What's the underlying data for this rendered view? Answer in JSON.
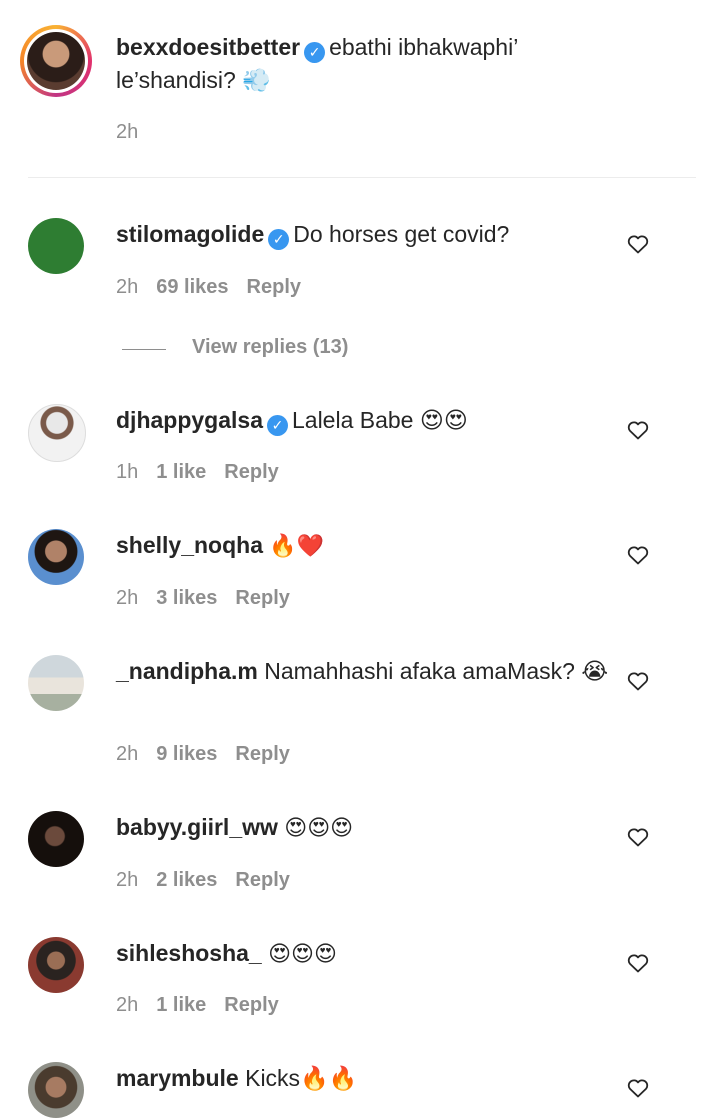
{
  "caption": {
    "username": "bexxdoesitbetter",
    "text": "ebathi ibhakwaphi’ le’shandisi? 💨",
    "time": "2h"
  },
  "comments": [
    {
      "username": "stilomagolide",
      "verified": true,
      "text": "Do horses get covid?",
      "time": "2h",
      "likes": "69 likes",
      "reply": "Reply",
      "avatar_color": "#2e7d32"
    },
    {
      "username": "djhappygalsa",
      "verified": true,
      "text": "Lalela Babe 😍😍",
      "time": "1h",
      "likes": "1 like",
      "reply": "Reply"
    },
    {
      "username": "shelly_noqha",
      "verified": false,
      "text": "🔥❤️",
      "time": "2h",
      "likes": "3 likes",
      "reply": "Reply"
    },
    {
      "username": "_nandipha.m",
      "verified": false,
      "text": "Namahhashi afaka amaMask? 😭",
      "time": "2h",
      "likes": "9 likes",
      "reply": "Reply"
    },
    {
      "username": "babyy.giirl_ww",
      "verified": false,
      "text": "😍😍😍",
      "time": "2h",
      "likes": "2 likes",
      "reply": "Reply"
    },
    {
      "username": "sihleshosha_",
      "verified": false,
      "text": "😍😍😍",
      "time": "2h",
      "likes": "1 like",
      "reply": "Reply"
    },
    {
      "username": "marymbule",
      "verified": false,
      "text": "Kicks🔥🔥"
    }
  ],
  "view_replies": "View replies (13)",
  "icons": {
    "verified": "verified-badge-icon",
    "like": "heart-outline-icon"
  },
  "colors": {
    "verified": "#3897f0",
    "meta": "#8e8e8e",
    "text": "#262626"
  }
}
